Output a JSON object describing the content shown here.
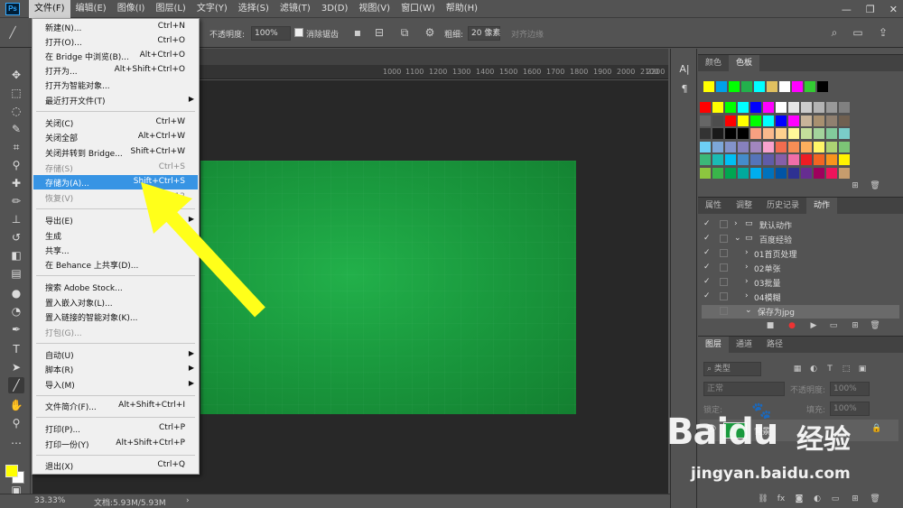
{
  "menubar": {
    "logo": "Ps",
    "items": [
      "文件(F)",
      "编辑(E)",
      "图像(I)",
      "图层(L)",
      "文字(Y)",
      "选择(S)",
      "滤镜(T)",
      "3D(D)",
      "视图(V)",
      "窗口(W)",
      "帮助(H)"
    ],
    "minimize": "—",
    "restore": "❐",
    "close": "✕"
  },
  "options": {
    "opacity_label": "不透明度:",
    "opacity_value": "100%",
    "antialias_label": "消除锯齿",
    "weight_label": "粗细:",
    "weight_value": "20 像素",
    "align_label": "对齐边缘"
  },
  "ruler": [
    "1000",
    "1100",
    "1200",
    "1300",
    "1400",
    "1500",
    "1600",
    "1700",
    "1800",
    "1900",
    "2000",
    "2100",
    "2200"
  ],
  "file_menu": {
    "items": [
      {
        "label": "新建(N)...",
        "shortcut": "Ctrl+N"
      },
      {
        "label": "打开(O)...",
        "shortcut": "Ctrl+O"
      },
      {
        "label": "在 Bridge 中浏览(B)...",
        "shortcut": "Alt+Ctrl+O"
      },
      {
        "label": "打开为...",
        "shortcut": "Alt+Shift+Ctrl+O"
      },
      {
        "label": "打开为智能对象...",
        "shortcut": ""
      },
      {
        "label": "最近打开文件(T)",
        "shortcut": ""
      },
      {
        "label": "关闭(C)",
        "shortcut": "Ctrl+W"
      },
      {
        "label": "关闭全部",
        "shortcut": "Alt+Ctrl+W"
      },
      {
        "label": "关闭并转到 Bridge...",
        "shortcut": "Shift+Ctrl+W"
      },
      {
        "label": "存储(S)",
        "shortcut": "Ctrl+S"
      },
      {
        "label": "存储为(A)...",
        "shortcut": "Shift+Ctrl+S"
      },
      {
        "label": "恢复(V)",
        "shortcut": "F12"
      },
      {
        "label": "导出(E)",
        "shortcut": ""
      },
      {
        "label": "生成",
        "shortcut": ""
      },
      {
        "label": "共享...",
        "shortcut": ""
      },
      {
        "label": "在 Behance 上共享(D)...",
        "shortcut": ""
      },
      {
        "label": "搜索 Adobe Stock...",
        "shortcut": ""
      },
      {
        "label": "置入嵌入对象(L)...",
        "shortcut": ""
      },
      {
        "label": "置入链接的智能对象(K)...",
        "shortcut": ""
      },
      {
        "label": "打包(G)...",
        "shortcut": ""
      },
      {
        "label": "自动(U)",
        "shortcut": ""
      },
      {
        "label": "脚本(R)",
        "shortcut": ""
      },
      {
        "label": "导入(M)",
        "shortcut": ""
      },
      {
        "label": "文件简介(F)...",
        "shortcut": "Alt+Shift+Ctrl+I"
      },
      {
        "label": "打印(P)...",
        "shortcut": "Ctrl+P"
      },
      {
        "label": "打印一份(Y)",
        "shortcut": "Alt+Shift+Ctrl+P"
      },
      {
        "label": "退出(X)",
        "shortcut": "Ctrl+Q"
      }
    ]
  },
  "swatch_panel": {
    "tabs": [
      "颜色",
      "色板"
    ],
    "recent": [
      "#ffff00",
      "#00a0e9",
      "#00ff00",
      "#22b14c",
      "#00ffff",
      "#e0c060",
      "#ffffff",
      "#ff00ff",
      "#33cc33",
      "#000000"
    ],
    "grid": [
      [
        "#ff0000",
        "#ffff00",
        "#00ff00",
        "#00ffff",
        "#0000ff",
        "#ff00ff",
        "#ffffff",
        "#e6e6e6",
        "#cccccc",
        "#b3b3b3",
        "#999999",
        "#808080"
      ],
      [
        "#666666",
        "#4d4d4d",
        "#ff0000",
        "#ffff00",
        "#00ff00",
        "#00ffff",
        "#0000ff",
        "#ff00ff",
        "#c8b49a",
        "#a89070",
        "#908070",
        "#706050"
      ],
      [
        "#333333",
        "#1a1a1a",
        "#000000",
        "#000000",
        "#f7a081",
        "#f9b98c",
        "#fdd08e",
        "#fff799",
        "#c4df9b",
        "#a3d39c",
        "#82ca9c",
        "#7accc8"
      ],
      [
        "#6dcff6",
        "#7da7d9",
        "#8393ca",
        "#8781bd",
        "#a186be",
        "#f9a2cd",
        "#f26c4f",
        "#f68e55",
        "#fbaf5d",
        "#fff568",
        "#acd373",
        "#7cc576"
      ],
      [
        "#3bb878",
        "#1abbb4",
        "#00bff3",
        "#448ccb",
        "#5574b9",
        "#605ca8",
        "#855fa8",
        "#f06ea9",
        "#ed1c24",
        "#f26522",
        "#f7941d",
        "#fff200"
      ],
      [
        "#8dc63f",
        "#39b54a",
        "#00a651",
        "#00a99d",
        "#00aeef",
        "#0072bc",
        "#0054a6",
        "#2e3192",
        "#662d91",
        "#9e005d",
        "#ed145b",
        "#c69c6d"
      ]
    ]
  },
  "actions_panel": {
    "tabs": [
      "属性",
      "调整",
      "历史记录",
      "动作"
    ],
    "rows": [
      {
        "check": "✓",
        "label": "默认动作",
        "indent": 0
      },
      {
        "check": "✓",
        "label": "百度经验",
        "indent": 0
      },
      {
        "check": "✓",
        "label": "01首页处理",
        "indent": 1
      },
      {
        "check": "✓",
        "label": "02单张",
        "indent": 1
      },
      {
        "check": "✓",
        "label": "03批量",
        "indent": 1
      },
      {
        "check": "✓",
        "label": "04模糊",
        "indent": 1
      },
      {
        "check": "",
        "label": "保存为jpg",
        "indent": 1
      }
    ]
  },
  "layers_panel": {
    "tabs": [
      "图层",
      "通道",
      "路径"
    ],
    "filter": "类型",
    "blend": "正常",
    "opacity_label": "不透明度:",
    "opacity_value": "100%",
    "lock_label": "锁定:",
    "fill_label": "填充:",
    "fill_value": "100%",
    "layer_name": "背景"
  },
  "status": {
    "zoom": "33.33%",
    "doc": "文档:5.93M/5.93M"
  },
  "watermark": {
    "brand": "Baidu",
    "cn": "经验",
    "url": "jingyan.baidu.com"
  }
}
